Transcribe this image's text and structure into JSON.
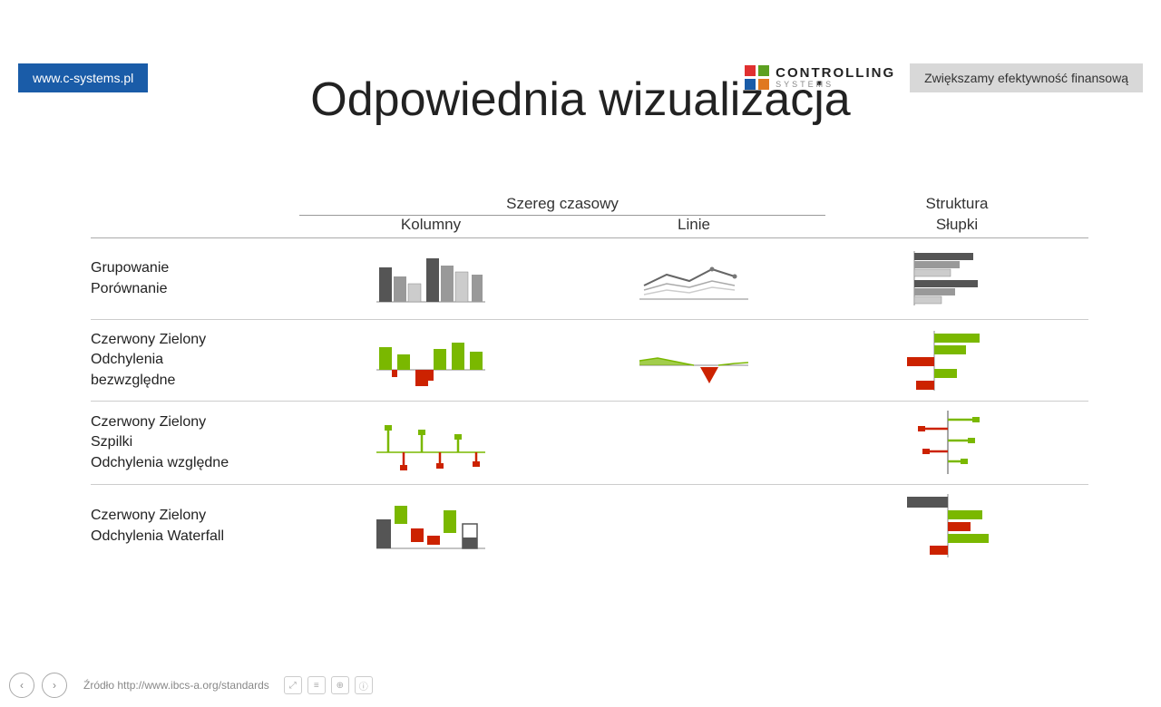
{
  "topbar": {
    "website": "www.c-systems.pl",
    "tagline": "Zwiększamy efektywność finansową"
  },
  "logo": {
    "controlling": "CONTROLLING",
    "systems": "SYSTEMS"
  },
  "title": "Odpowiednia wizualizacja",
  "table": {
    "header_group": "Szereg czasowy",
    "col1": "Kolumny",
    "col2": "Linie",
    "col3": "Słupki",
    "col_left": "Struktura",
    "rows": [
      {
        "label_lines": [
          "Grupowanie",
          "Porównanie"
        ],
        "col1_type": "grouped_bars",
        "col2_type": "lines",
        "col3_type": "horiz_bars"
      },
      {
        "label_lines": [
          "Czerwony Zielony",
          "Odchylenia",
          "bezwzględne"
        ],
        "col1_type": "red_green_cols",
        "col2_type": "red_green_line",
        "col3_type": "red_green_horiz"
      },
      {
        "label_lines": [
          "Czerwony Zielony",
          "Szpilki",
          "Odchylenia względne"
        ],
        "col1_type": "needle_cols",
        "col2_type": null,
        "col3_type": "needle_horiz"
      },
      {
        "label_lines": [
          "Czerwony Zielony",
          "Odchylenia Waterfall"
        ],
        "col1_type": "waterfall",
        "col2_type": null,
        "col3_type": "waterfall_horiz"
      }
    ]
  },
  "footer": {
    "source": "Źródło http://www.ibcs-a.org/standards"
  },
  "colors": {
    "dark_gray": "#555",
    "light_gray": "#bbb",
    "red": "#cc2200",
    "green": "#7ab800",
    "white_outline": "#fff"
  }
}
